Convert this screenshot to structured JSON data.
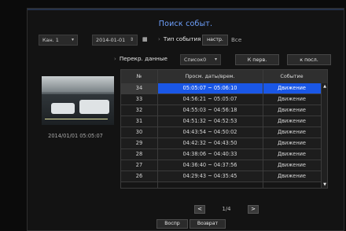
{
  "title": "Поиск событ.",
  "controls": {
    "channel": "Кан. 1",
    "date": "2014-01-01",
    "event_type_label": "Тип события",
    "setup_button": "настр.",
    "all_text": "Все"
  },
  "row2": {
    "label": "Перекр. данные",
    "list_select": "Список0",
    "first_button": "К перв.",
    "last_button": "к посл."
  },
  "preview": {
    "timestamp": "2014/01/01 05:05:07"
  },
  "table": {
    "headers": [
      "№",
      "Просм. даты/врем.",
      "Событие"
    ],
    "rows": [
      {
        "no": "34",
        "time": "05:05:07 ~ 05:06:10",
        "event": "Движение",
        "selected": true
      },
      {
        "no": "33",
        "time": "04:56:21 ~ 05:05:07",
        "event": "Движение"
      },
      {
        "no": "32",
        "time": "04:55:03 ~ 04:56:18",
        "event": "Движение"
      },
      {
        "no": "31",
        "time": "04:51:32 ~ 04:52:53",
        "event": "Движение"
      },
      {
        "no": "30",
        "time": "04:43:54 ~ 04:50:02",
        "event": "Движение"
      },
      {
        "no": "29",
        "time": "04:42:32 ~ 04:43:50",
        "event": "Движение"
      },
      {
        "no": "28",
        "time": "04:38:06 ~ 04:40:33",
        "event": "Движение"
      },
      {
        "no": "27",
        "time": "04:36:40 ~ 04:37:56",
        "event": "Движение"
      },
      {
        "no": "26",
        "time": "04:29:43 ~ 04:35:45",
        "event": "Движение"
      }
    ]
  },
  "pager": {
    "prev": "<",
    "page": "1/4",
    "next": ">"
  },
  "footer": {
    "play_button": "Воспр",
    "return_button": "Возврат"
  },
  "colors": {
    "accent": "#1a57e6",
    "title": "#6fa2ff"
  },
  "icons": {
    "date_spinner": "spinner-icon",
    "calendar": "calendar-icon",
    "dropdown": "chevron-down-icon",
    "scroll_up": "triangle-up-icon",
    "scroll_down": "triangle-down-icon"
  }
}
